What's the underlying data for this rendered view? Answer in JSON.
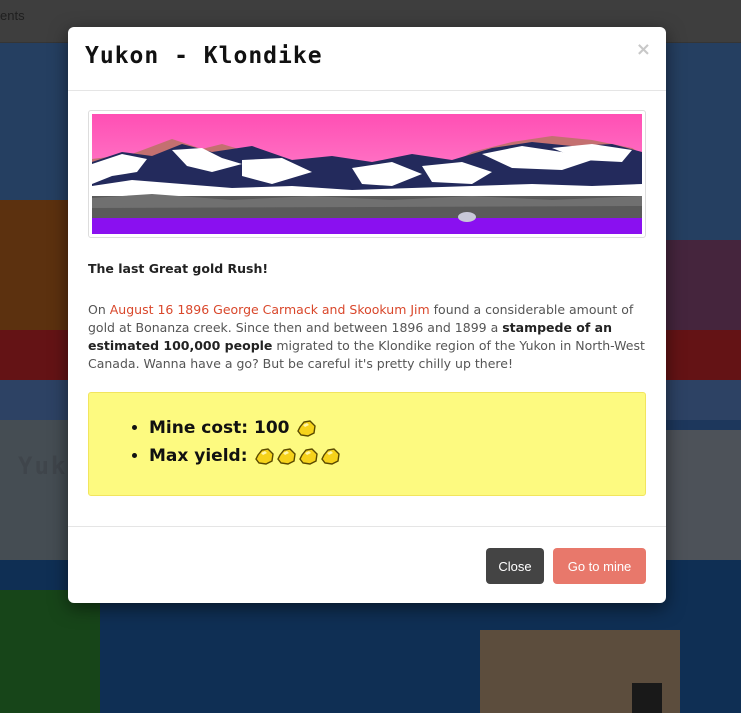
{
  "background": {
    "nav_text": "ents",
    "map_label": "Yuk"
  },
  "modal": {
    "title": "Yukon - Klondike",
    "close_glyph": "×",
    "heading": "The last Great gold Rush!",
    "paragraph": {
      "part1": "On ",
      "link": "August 16 1896 George Carmack and Skookum Jim",
      "part2": " found a considerable amount of gold at Bonanza creek. Since then and between 1896 and 1899 a ",
      "bold1": "stampede of an estimated 100,000 people",
      "part3": " migrated to the Klondike region of the Yukon in North-West Canada. Wanna have a go? But be careful it's pretty chilly up there!"
    },
    "stats": {
      "mine_cost_label": "Mine cost: 100",
      "mine_cost_nuggets": 1,
      "max_yield_label": "Max yield:",
      "max_yield_nuggets": 4
    },
    "buttons": {
      "close": "Close",
      "go": "Go to mine"
    }
  },
  "colors": {
    "link": "#d9472b",
    "yield_box": "#fdfa80",
    "close_button": "#444444",
    "go_button": "#e8786b"
  },
  "icons": {
    "nugget": "gold-nugget-icon",
    "close": "close-icon"
  }
}
